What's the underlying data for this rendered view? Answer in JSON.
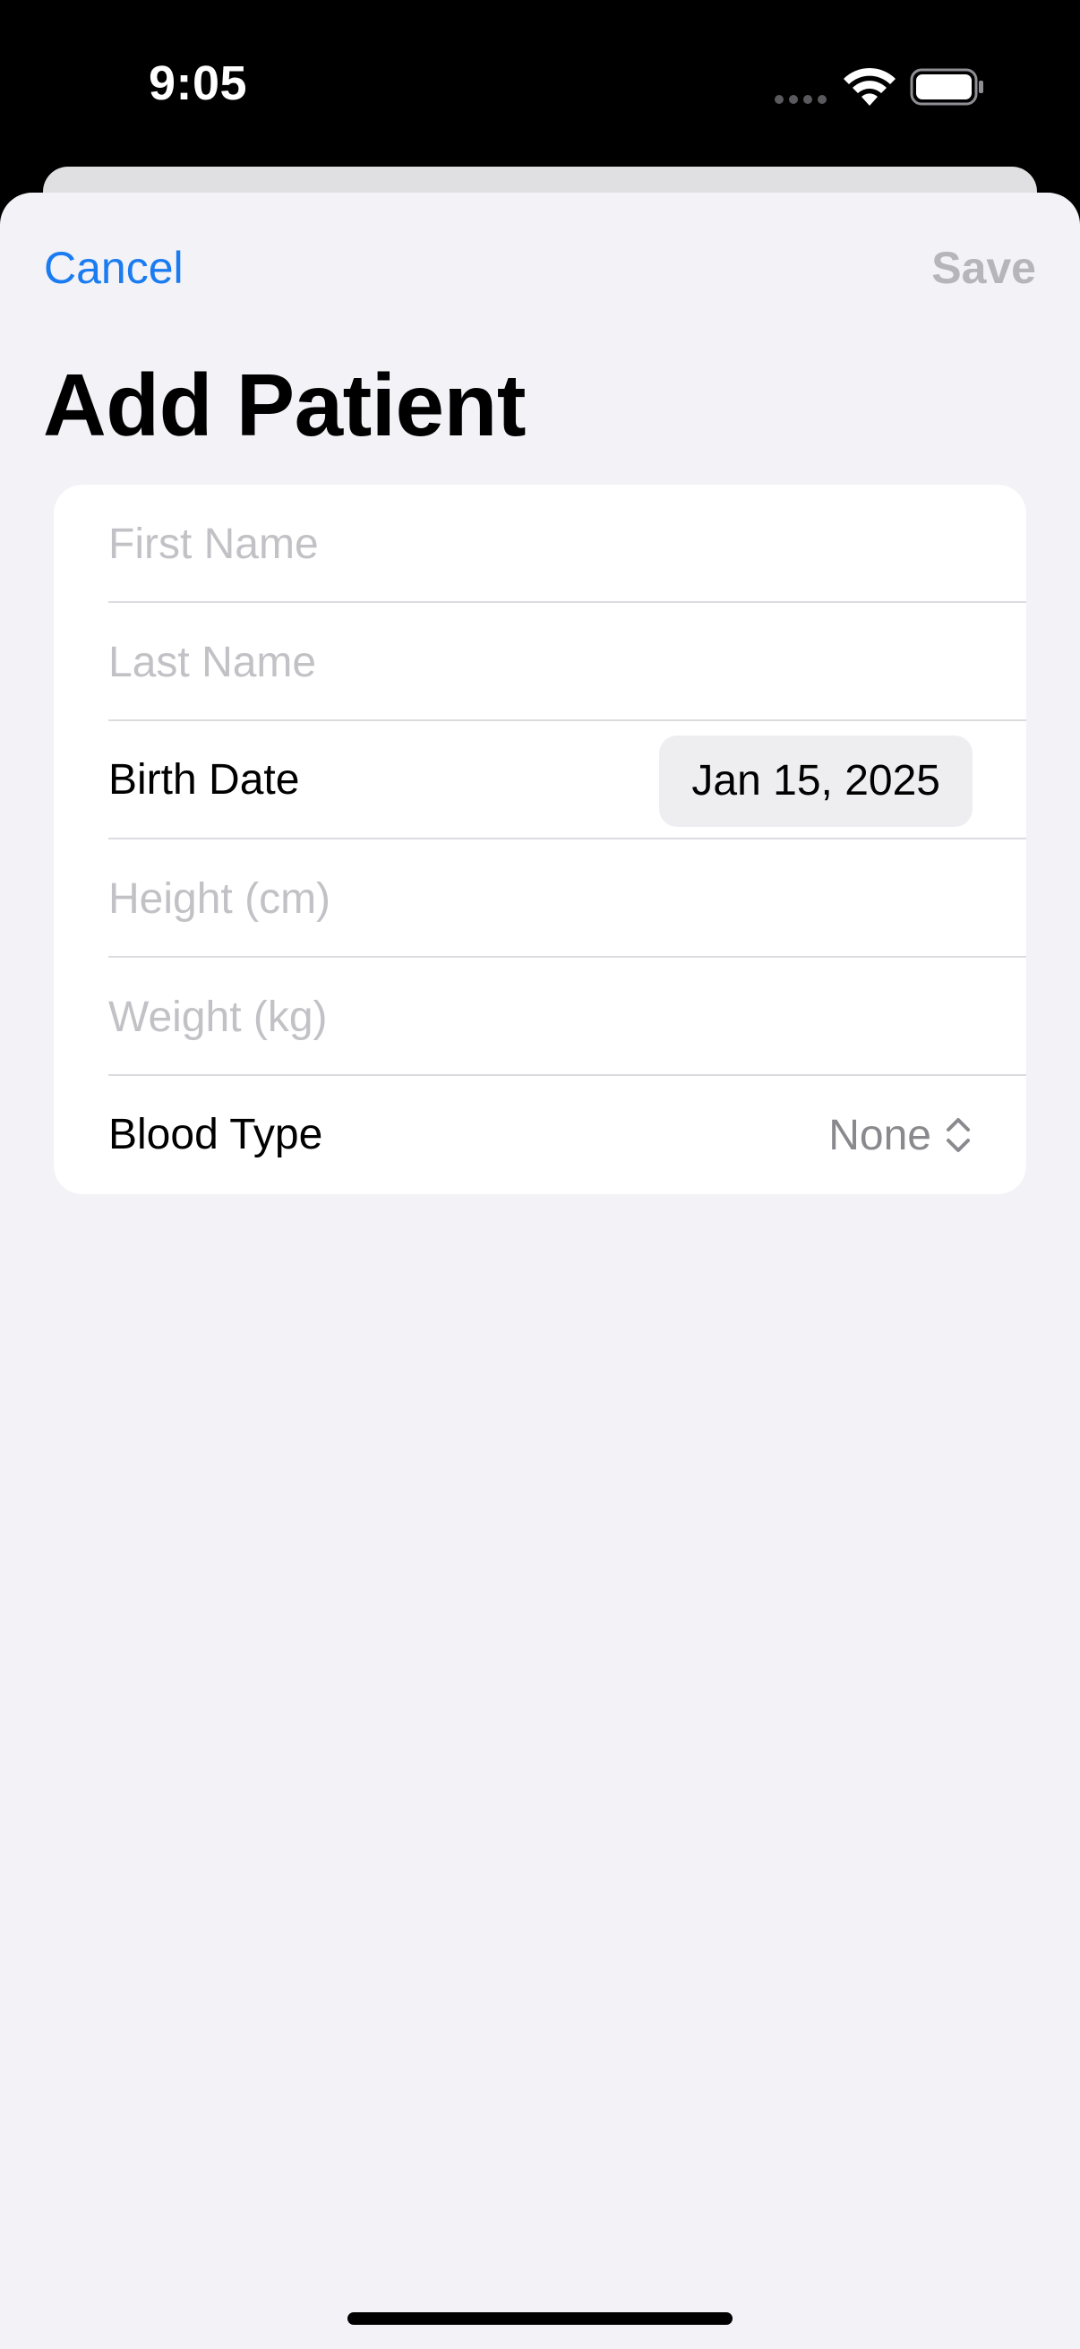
{
  "status_bar": {
    "time": "9:05",
    "icons": [
      "cellular-dots-icon",
      "wifi-icon",
      "battery-icon"
    ]
  },
  "nav": {
    "cancel_label": "Cancel",
    "save_label": "Save"
  },
  "title": "Add Patient",
  "form": {
    "first_name": {
      "placeholder": "First Name",
      "value": ""
    },
    "last_name": {
      "placeholder": "Last Name",
      "value": ""
    },
    "birth_date": {
      "label": "Birth Date",
      "value": "Jan 15, 2025"
    },
    "height": {
      "placeholder": "Height (cm)",
      "value": ""
    },
    "weight": {
      "placeholder": "Weight (kg)",
      "value": ""
    },
    "blood_type": {
      "label": "Blood Type",
      "value": "None",
      "icon": "chevron-up-down-icon"
    }
  },
  "colors": {
    "accent": "#1a7cf0",
    "disabled": "#b5b5ba",
    "background": "#f2f2f7",
    "card": "#ffffff",
    "placeholder": "#c2c2c6",
    "secondary_text": "#8a8a8e"
  }
}
